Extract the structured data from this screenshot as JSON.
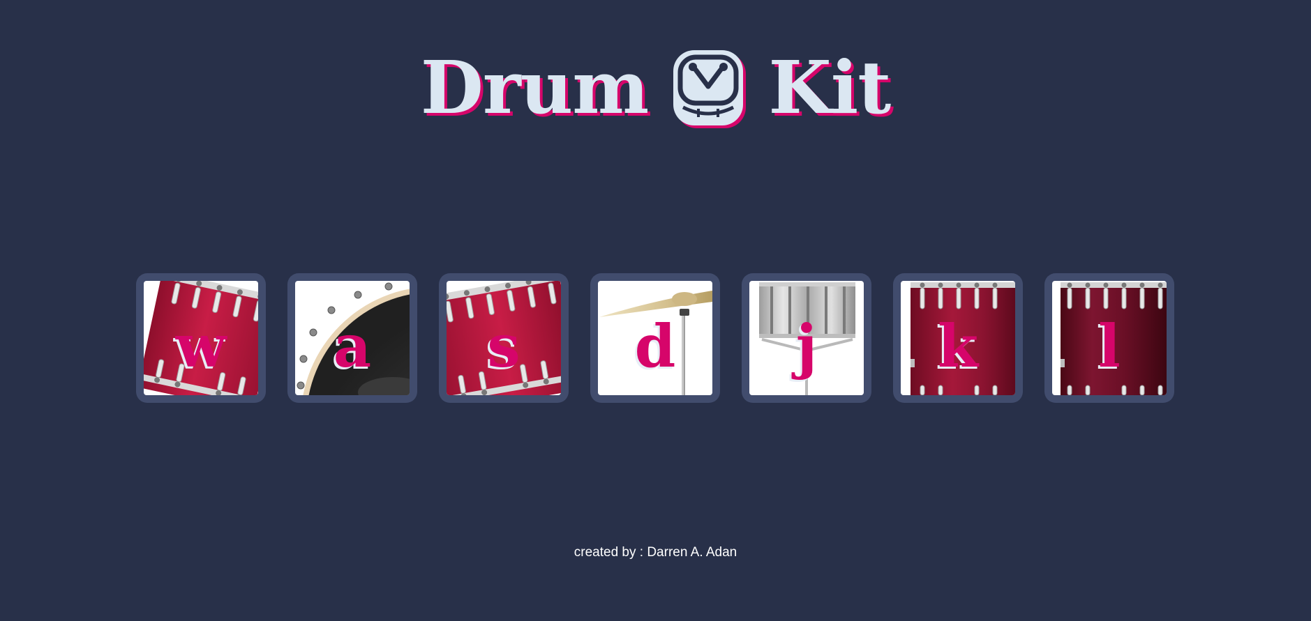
{
  "header": {
    "title_left": "Drum",
    "title_right": "Kit",
    "logo_icon": "drum-icon"
  },
  "pads": [
    {
      "key": "w",
      "label": "w",
      "icon": "tom-drum-icon"
    },
    {
      "key": "a",
      "label": "a",
      "icon": "bass-drum-icon"
    },
    {
      "key": "s",
      "label": "s",
      "icon": "tom-drum-icon"
    },
    {
      "key": "d",
      "label": "d",
      "icon": "cymbal-icon"
    },
    {
      "key": "j",
      "label": "j",
      "icon": "snare-drum-icon"
    },
    {
      "key": "k",
      "label": "k",
      "icon": "floor-tom-icon"
    },
    {
      "key": "l",
      "label": "l",
      "icon": "floor-tom-icon"
    }
  ],
  "footer": {
    "credit": "created by : Darren A. Adan"
  },
  "colors": {
    "background": "#283049",
    "pad_frame": "#414c6d",
    "accent": "#d6056a",
    "title_text": "#dbe7f2",
    "drum_red": "#b8163d"
  }
}
